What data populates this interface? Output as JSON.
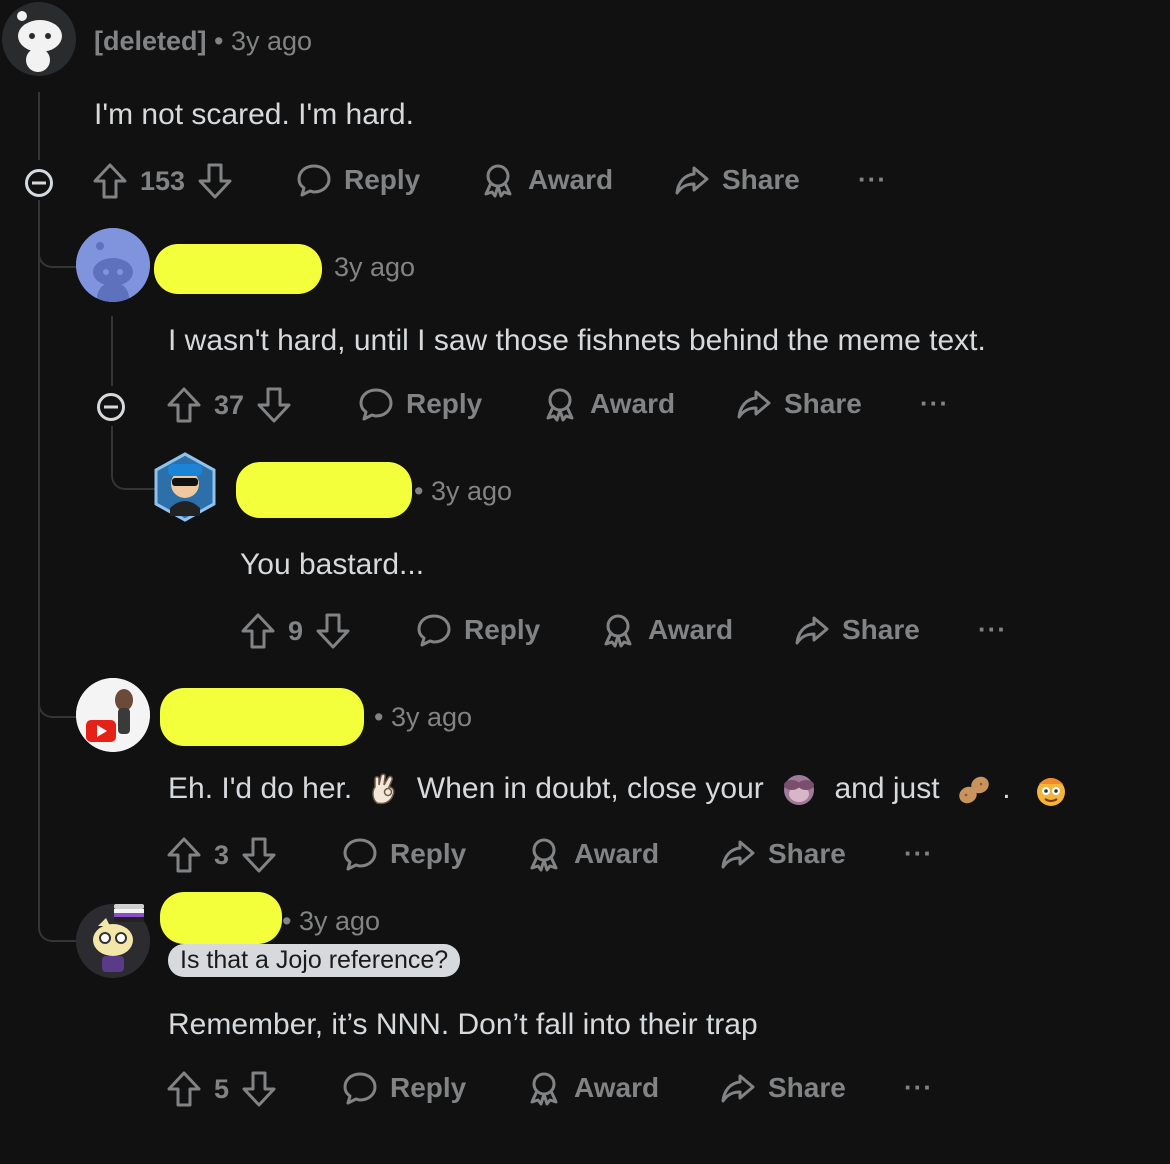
{
  "comments": [
    {
      "author": "[deleted]",
      "time": "3y ago",
      "text": "I'm not scared. I'm hard.",
      "votes": "153"
    },
    {
      "time": "3y ago",
      "text": "I wasn't hard, until I saw those fishnets behind the meme text.",
      "votes": "37"
    },
    {
      "time": "3y ago",
      "text": "You bastard...",
      "votes": "9"
    },
    {
      "time": "3y ago",
      "text_parts": [
        "Eh. I'd do her.",
        "When in doubt, close your",
        "and just",
        "."
      ],
      "emojis": [
        "ok-hand",
        "see-no-evil",
        "peanut",
        "smiling-face"
      ],
      "votes": "3"
    },
    {
      "time": "3y ago",
      "flair": "Is that a Jojo reference?",
      "text": "Remember, it’s NNN. Don’t fall into their trap",
      "votes": "5"
    }
  ],
  "actions": {
    "reply": "Reply",
    "award": "Award",
    "share": "Share",
    "more": "···"
  },
  "colors": {
    "background": "#111112",
    "text": "#d7dadc",
    "muted": "#818384",
    "redaction": "#f3ff3a"
  }
}
